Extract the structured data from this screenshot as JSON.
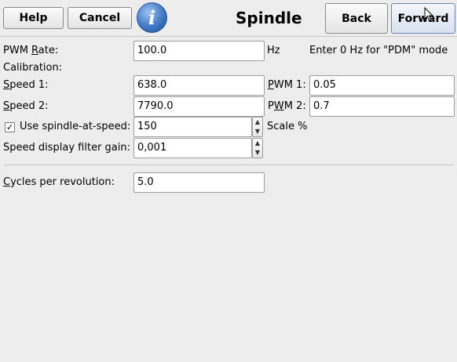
{
  "toolbar": {
    "help_label": "Help",
    "cancel_label": "Cancel",
    "info_icon_glyph": "i",
    "title": "Spindle",
    "back_label": "Back",
    "forward_label": "Forward"
  },
  "form": {
    "pwm_rate": {
      "label_pre": "PWM ",
      "label_ul": "R",
      "label_post": "ate:",
      "value": "100.0",
      "unit": "Hz"
    },
    "pdm_hint": "Enter 0 Hz for \"PDM\" mode",
    "calibration_label": "Calibration:",
    "speed1": {
      "label_ul": "S",
      "label_post": "peed 1:",
      "value": "638.0"
    },
    "pwm1": {
      "label_ul": "P",
      "label_post": "WM 1:",
      "value": "0.05"
    },
    "speed2": {
      "label_ul": "S",
      "label_post": "peed 2:",
      "value": "7790.0"
    },
    "pwm2": {
      "label_pre": "P",
      "label_ul": "W",
      "label_post": "M 2:",
      "value": "0.7"
    },
    "use_spindle_at_speed": {
      "checked": true,
      "check_glyph": "✓",
      "label": "Use spindle-at-speed:",
      "value": "150",
      "unit": "Scale %"
    },
    "speed_filter": {
      "label": "Speed display filter gain:",
      "value": "0,001"
    },
    "cycles": {
      "label_ul": "C",
      "label_post": "ycles per revolution:",
      "value": "5.0"
    }
  },
  "icons": {
    "spin_up": "▲",
    "spin_down": "▼"
  }
}
